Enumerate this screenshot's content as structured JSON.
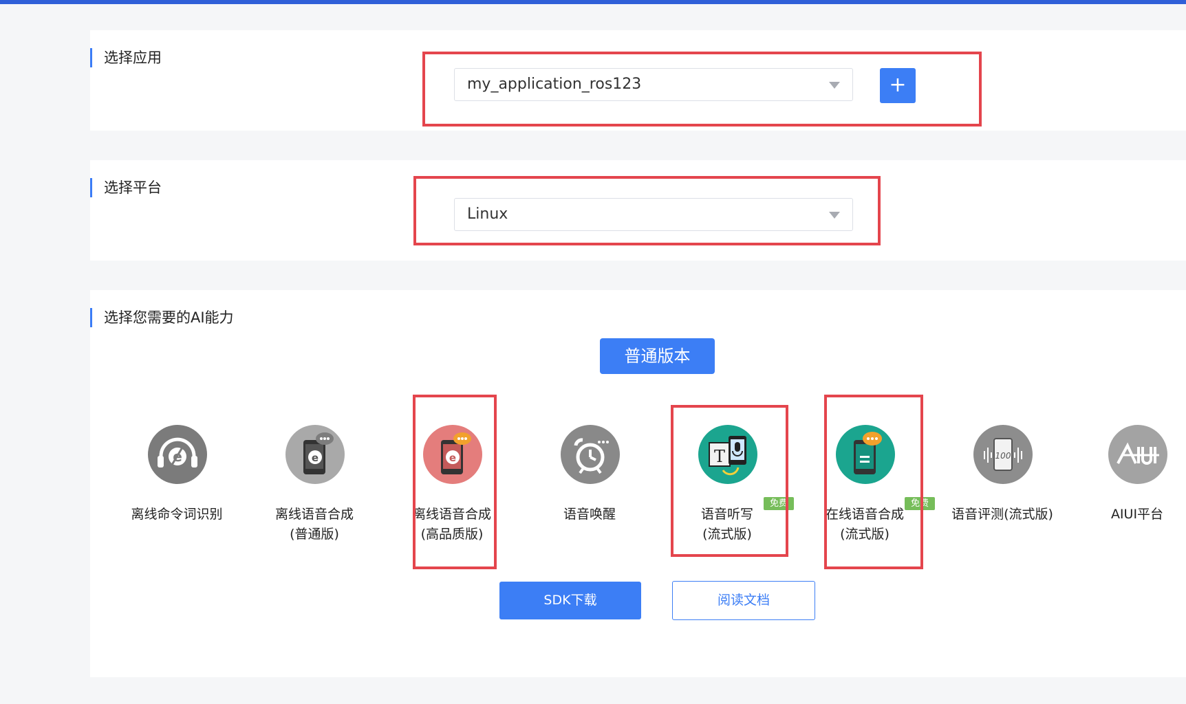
{
  "app_section": {
    "title": "选择应用",
    "selected_app": "my_application_ros123",
    "add_label": "+"
  },
  "platform_section": {
    "title": "选择平台",
    "selected_platform": "Linux"
  },
  "ai_section": {
    "title": "选择您需要的AI能力",
    "version_label": "普通版本",
    "capabilities": [
      {
        "line1": "离线命令词识别",
        "line2": "",
        "icon": "headset-microphone-icon",
        "color": "#7b7b7b"
      },
      {
        "line1": "离线语音合成",
        "line2": "(普通版)",
        "icon": "phone-speech-icon",
        "color": "#a9a9a9"
      },
      {
        "line1": "离线语音合成",
        "line2": "(高品质版)",
        "icon": "phone-speech-premium-icon",
        "color": "#e47d7c"
      },
      {
        "line1": "语音唤醒",
        "line2": "",
        "icon": "alarm-clock-icon",
        "color": "#898989"
      },
      {
        "line1": "语音听写",
        "line2": "(流式版)",
        "icon": "text-microphone-icon",
        "color": "#1ba58f",
        "badge": "免费"
      },
      {
        "line1": "在线语音合成",
        "line2": "(流式版)",
        "icon": "phone-chat-icon",
        "color": "#1ba58f",
        "badge": "免费"
      },
      {
        "line1": "语音评测(流式版)",
        "line2": "",
        "icon": "waveform-score-icon",
        "color": "#8d8d8d"
      },
      {
        "line1": "AIUI平台",
        "line2": "",
        "icon": "aiui-logo-icon",
        "color": "#a3a3a3"
      }
    ],
    "sdk_download_label": "SDK下载",
    "read_docs_label": "阅读文档"
  },
  "colors": {
    "accent_blue": "#3c7ef5",
    "highlight_red": "#e4454d",
    "badge_green": "#76bd5a"
  }
}
